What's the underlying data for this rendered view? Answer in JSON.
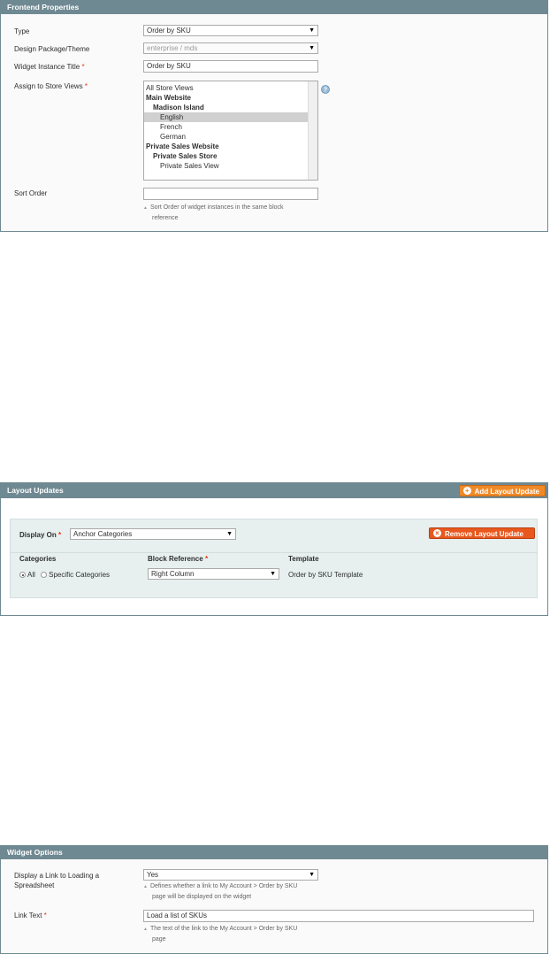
{
  "frontend": {
    "title": "Frontend Properties",
    "type_label": "Type",
    "type_value": "Order by SKU",
    "design_label": "Design Package/Theme",
    "design_value": "enterprise / mds",
    "instance_title_label": "Widget Instance Title",
    "instance_title_value": "Order by SKU",
    "store_views_label": "Assign to Store Views",
    "required_mark": "*",
    "store_views": [
      {
        "label": "All Store Views"
      },
      {
        "label": "Main Website"
      },
      {
        "label": "Madison Island"
      },
      {
        "label": "English"
      },
      {
        "label": "French"
      },
      {
        "label": "German"
      },
      {
        "label": "Private Sales Website"
      },
      {
        "label": "Private Sales Store"
      },
      {
        "label": "Private Sales View"
      }
    ],
    "sort_order_label": "Sort Order",
    "sort_order_value": "",
    "sort_note_line1": "Sort Order of widget instances in the same block",
    "sort_note_line2": "reference"
  },
  "layout": {
    "title": "Layout Updates",
    "add_button": "Add Layout Update",
    "display_on_label": "Display On",
    "display_on_value": "Anchor Categories",
    "remove_button": "Remove Layout Update",
    "categories_header": "Categories",
    "block_reference_header": "Block Reference",
    "template_header": "Template",
    "radio_all": "All",
    "radio_specific": "Specific Categories",
    "block_reference_value": "Right Column",
    "template_value": "Order by SKU Template"
  },
  "widget": {
    "title": "Widget Options",
    "display_link_label_line1": "Display a Link to Loading a",
    "display_link_label_line2": "Spreadsheet",
    "display_link_value": "Yes",
    "display_link_note_line1": "Defines whether a link to My Account > Order by SKU",
    "display_link_note_line2": "page will be displayed on the widget",
    "link_text_label": "Link Text",
    "link_text_value": "Load a list of SKUs",
    "link_text_note_line1": "The text of the link to the My Account > Order by SKU",
    "link_text_note_line2": "page"
  },
  "colors": {
    "header": "#6f8992",
    "orange_button": "#f08a28",
    "red_button": "#e8581e",
    "required": "#eb340a"
  },
  "icons": {
    "help": "help-icon",
    "add": "plus-circle-icon",
    "remove": "x-circle-icon",
    "dropdown": "dropdown-arrow-icon"
  }
}
